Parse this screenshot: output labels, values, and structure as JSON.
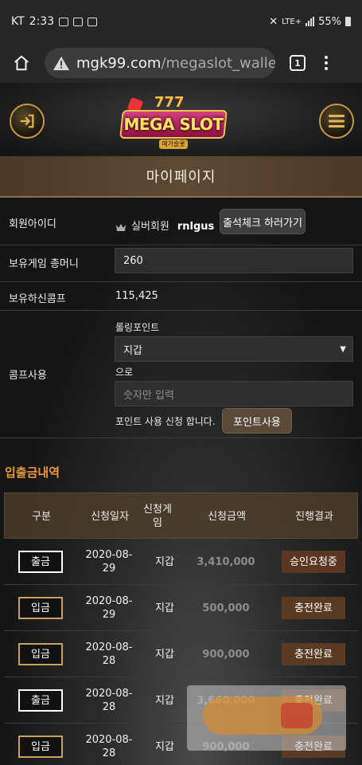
{
  "status_bar": {
    "carrier": "KT",
    "time": "2:33",
    "network": "LTE+",
    "battery": "55%"
  },
  "browser": {
    "url_domain": "mgk99.com",
    "url_path": "/megaslot_wallet",
    "tab_count": "1"
  },
  "header": {
    "logo_text": "MEGA SLOT",
    "logo_sub": "메가슬롯",
    "logo_777": "777"
  },
  "page": {
    "title": "마이페이지"
  },
  "info": {
    "member_id_label": "회원아이디",
    "member_grade": "실버회원",
    "member_id": "rnlgus",
    "attendance_button": "출석체크 하러가기",
    "game_money_label": "보유게임 총머니",
    "game_money_value": "260",
    "comp_label": "보유하신콤프",
    "comp_value": "115,425",
    "comp_use_label": "콤프사용",
    "rolling_point_label": "롤링포인트",
    "wallet_select_value": "지갑",
    "to_label": "으로",
    "number_placeholder": "숫자만 입력",
    "apply_text": "포인트 사용 신청 합니다.",
    "point_use_button": "포인트사용"
  },
  "history": {
    "section_title": "입출금내역",
    "columns": [
      "구분",
      "신청일자",
      "신청게임",
      "신청금액",
      "진행결과"
    ],
    "rows": [
      {
        "type": "출금",
        "date": "2020-08-29",
        "game": "지갑",
        "amount": "3,410,000",
        "result": "승인요청중"
      },
      {
        "type": "입금",
        "date": "2020-08-29",
        "game": "지갑",
        "amount": "500,000",
        "result": "충전완료"
      },
      {
        "type": "입금",
        "date": "2020-08-28",
        "game": "지갑",
        "amount": "900,000",
        "result": "충전완료"
      },
      {
        "type": "출금",
        "date": "2020-08-28",
        "game": "지갑",
        "amount": "3,660,000",
        "result": "충전완료"
      },
      {
        "type": "입금",
        "date": "2020-08-28",
        "game": "지갑",
        "amount": "900,000",
        "result": "충전완료"
      }
    ]
  },
  "colors": {
    "accent_orange": "#e89a3c",
    "gold_border": "#c59a42",
    "title_band": "#5d4a33"
  }
}
